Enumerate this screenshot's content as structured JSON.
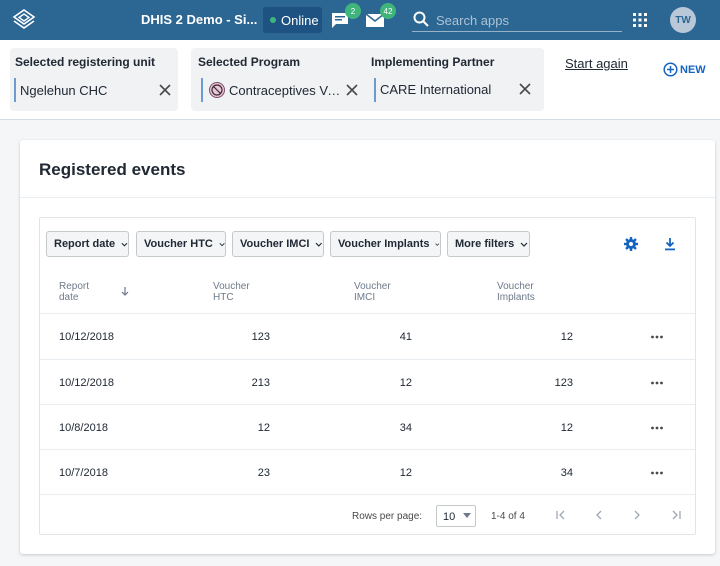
{
  "header": {
    "app_title": "DHIS 2 Demo - Si...",
    "online_label": "Online",
    "messages_count": "2",
    "interpretations_count": "42",
    "search_placeholder": "Search apps",
    "avatar_initials": "TW",
    "bg_color": "#2c6693"
  },
  "context": {
    "org_unit": {
      "label": "Selected registering unit",
      "value": "Ngelehun CHC"
    },
    "program": {
      "label": "Selected Program",
      "value": "Contraceptives Vo..."
    },
    "partner": {
      "label": "Implementing Partner",
      "value": "CARE International"
    },
    "start_again": "Start again",
    "new_label": "NEW"
  },
  "main": {
    "title": "Registered events",
    "filters": [
      "Report date",
      "Voucher HTC",
      "Voucher IMCI",
      "Voucher Implants",
      "More filters"
    ],
    "columns": [
      {
        "line1": "Report",
        "line2": "date"
      },
      {
        "line1": "Voucher",
        "line2": "HTC"
      },
      {
        "line1": "Voucher",
        "line2": "IMCI"
      },
      {
        "line1": "Voucher",
        "line2": "Implants"
      }
    ],
    "rows": [
      {
        "date": "10/12/2018",
        "htc": "123",
        "imci": "41",
        "implants": "12"
      },
      {
        "date": "10/12/2018",
        "htc": "213",
        "imci": "12",
        "implants": "123"
      },
      {
        "date": "10/8/2018",
        "htc": "12",
        "imci": "34",
        "implants": "12"
      },
      {
        "date": "10/7/2018",
        "htc": "23",
        "imci": "12",
        "implants": "34"
      }
    ],
    "pagination": {
      "rows_per_page_label": "Rows per page:",
      "rows_per_page_value": "10",
      "range": "1-4 of 4"
    }
  }
}
